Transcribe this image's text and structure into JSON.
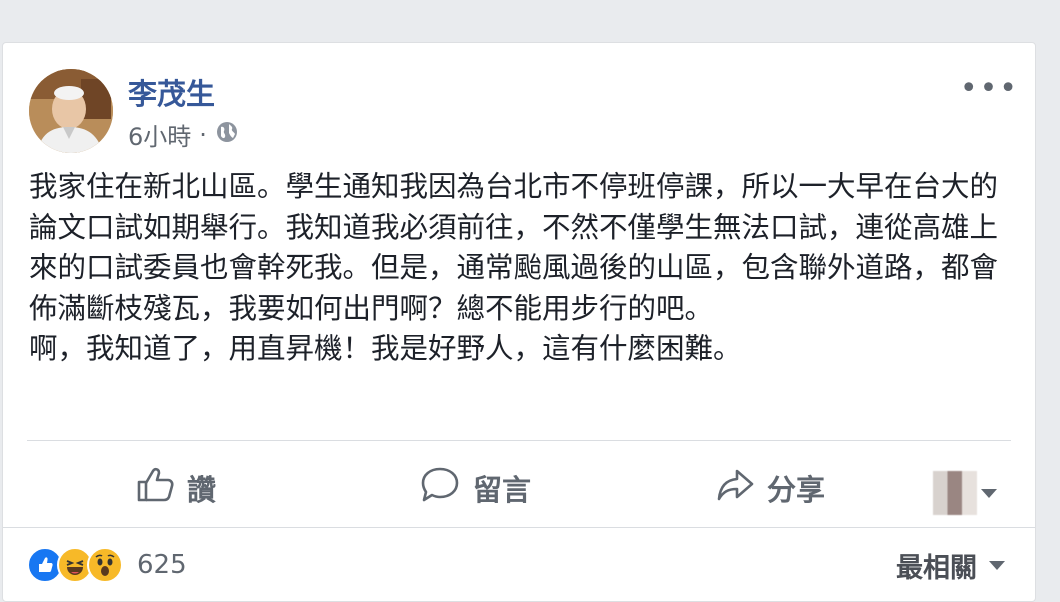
{
  "post": {
    "author": "李茂生",
    "time": "6小時",
    "separator": "·",
    "privacy_icon": "globe-icon",
    "more_label": "•••",
    "paragraphs": [
      "我家住在新北山區。學生通知我因為台北市不停班停課，所以一大早在台大的論文口試如期舉行。我知道我必須前往，不然不僅學生無法口試，連從高雄上來的口試委員也會幹死我。但是，通常颱風過後的山區，包含聯外道路，都會佈滿斷枝殘瓦，我要如何出門啊？總不能用步行的吧。",
      "啊，我知道了，用直昇機！我是好野人，這有什麼困難。"
    ]
  },
  "actions": {
    "like": "讚",
    "comment": "留言",
    "share": "分享"
  },
  "footer": {
    "reaction_count": "625",
    "reactions": [
      "like-icon",
      "haha-icon",
      "wow-icon"
    ],
    "sort_label": "最相關"
  },
  "colors": {
    "author_link": "#365899",
    "secondary_text": "#606770",
    "like_blue": "#1877f2",
    "emoji_yellow": "#f7b928"
  }
}
